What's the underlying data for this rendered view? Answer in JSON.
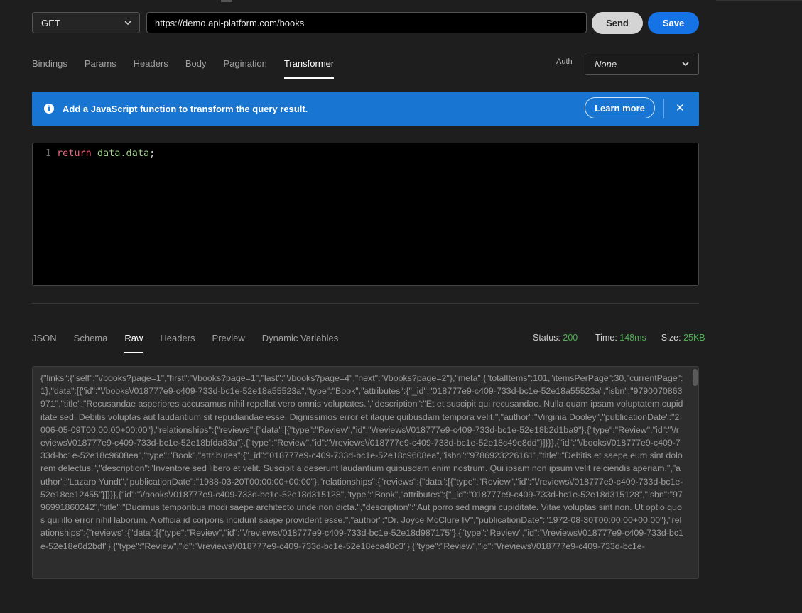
{
  "request": {
    "method": "GET",
    "url": "https://demo.api-platform.com/books",
    "send_label": "Send",
    "save_label": "Save"
  },
  "request_tabs": [
    {
      "label": "Bindings",
      "active": false
    },
    {
      "label": "Params",
      "active": false
    },
    {
      "label": "Headers",
      "active": false
    },
    {
      "label": "Body",
      "active": false
    },
    {
      "label": "Pagination",
      "active": false
    },
    {
      "label": "Transformer",
      "active": true
    }
  ],
  "auth": {
    "label": "Auth",
    "value": "None"
  },
  "banner": {
    "text": "Add a JavaScript function to transform the query result.",
    "learn_more": "Learn more",
    "close": "✕",
    "color": "#1876d2"
  },
  "editor": {
    "line_number": "1",
    "keyword": "return",
    "expression": "data.data",
    "terminator": ";"
  },
  "response_tabs": [
    {
      "label": "JSON",
      "active": false
    },
    {
      "label": "Schema",
      "active": false
    },
    {
      "label": "Raw",
      "active": true
    },
    {
      "label": "Headers",
      "active": false
    },
    {
      "label": "Preview",
      "active": false
    },
    {
      "label": "Dynamic Variables",
      "active": false
    }
  ],
  "status": {
    "status_label": "Status:",
    "status_value": "200",
    "time_label": "Time:",
    "time_value": "148ms",
    "size_label": "Size:",
    "size_value": "25KB",
    "value_color": "#4caf50"
  },
  "raw_body": "{\"links\":{\"self\":\"\\/books?page=1\",\"first\":\"\\/books?page=1\",\"last\":\"\\/books?page=4\",\"next\":\"\\/books?page=2\"},\"meta\":{\"totalItems\":101,\"itemsPerPage\":30,\"currentPage\":1},\"data\":[{\"id\":\"\\/books\\/018777e9-c409-733d-bc1e-52e18a55523a\",\"type\":\"Book\",\"attributes\":{\"_id\":\"018777e9-c409-733d-bc1e-52e18a55523a\",\"isbn\":\"9790070863971\",\"title\":\"Recusandae asperiores accusamus nihil repellat vero omnis voluptates.\",\"description\":\"Et et suscipit qui recusandae. Nulla quam ipsam voluptatem cupiditate sed. Debitis voluptas aut laudantium sit repudiandae esse. Dignissimos error et itaque quibusdam tempora velit.\",\"author\":\"Virginia Dooley\",\"publicationDate\":\"2006-05-09T00:00:00+00:00\"},\"relationships\":{\"reviews\":{\"data\":[{\"type\":\"Review\",\"id\":\"\\/reviews\\/018777e9-c409-733d-bc1e-52e18b2d1ba9\"},{\"type\":\"Review\",\"id\":\"\\/reviews\\/018777e9-c409-733d-bc1e-52e18bfda83a\"},{\"type\":\"Review\",\"id\":\"\\/reviews\\/018777e9-c409-733d-bc1e-52e18c49e8dd\"}]}}},{\"id\":\"\\/books\\/018777e9-c409-733d-bc1e-52e18c9608ea\",\"type\":\"Book\",\"attributes\":{\"_id\":\"018777e9-c409-733d-bc1e-52e18c9608ea\",\"isbn\":\"9786923226161\",\"title\":\"Debitis et saepe eum sint dolorem delectus.\",\"description\":\"Inventore sed libero et velit. Suscipit a deserunt laudantium quibusdam enim nostrum. Qui ipsam non ipsum velit reiciendis aperiam.\",\"author\":\"Lazaro Yundt\",\"publicationDate\":\"1988-03-20T00:00:00+00:00\"},\"relationships\":{\"reviews\":{\"data\":[{\"type\":\"Review\",\"id\":\"\\/reviews\\/018777e9-c409-733d-bc1e-52e18ce12455\"}]}}},{\"id\":\"\\/books\\/018777e9-c409-733d-bc1e-52e18d315128\",\"type\":\"Book\",\"attributes\":{\"_id\":\"018777e9-c409-733d-bc1e-52e18d315128\",\"isbn\":\"9796991860242\",\"title\":\"Ducimus temporibus modi saepe architecto unde non dicta.\",\"description\":\"Aut porro sed magni cupiditate. Vitae voluptas sint non. Ut optio quos qui illo error nihil laborum. A officia id corporis incidunt saepe provident esse.\",\"author\":\"Dr. Joyce McClure IV\",\"publicationDate\":\"1972-08-30T00:00:00+00:00\"},\"relationships\":{\"reviews\":{\"data\":[{\"type\":\"Review\",\"id\":\"\\/reviews\\/018777e9-c409-733d-bc1e-52e18d987175\"},{\"type\":\"Review\",\"id\":\"\\/reviews\\/018777e9-c409-733d-bc1e-52e18e0d2bdf\"},{\"type\":\"Review\",\"id\":\"\\/reviews\\/018777e9-c409-733d-bc1e-52e18eca40c3\"},{\"type\":\"Review\",\"id\":\"\\/reviews\\/018777e9-c409-733d-bc1e-"
}
